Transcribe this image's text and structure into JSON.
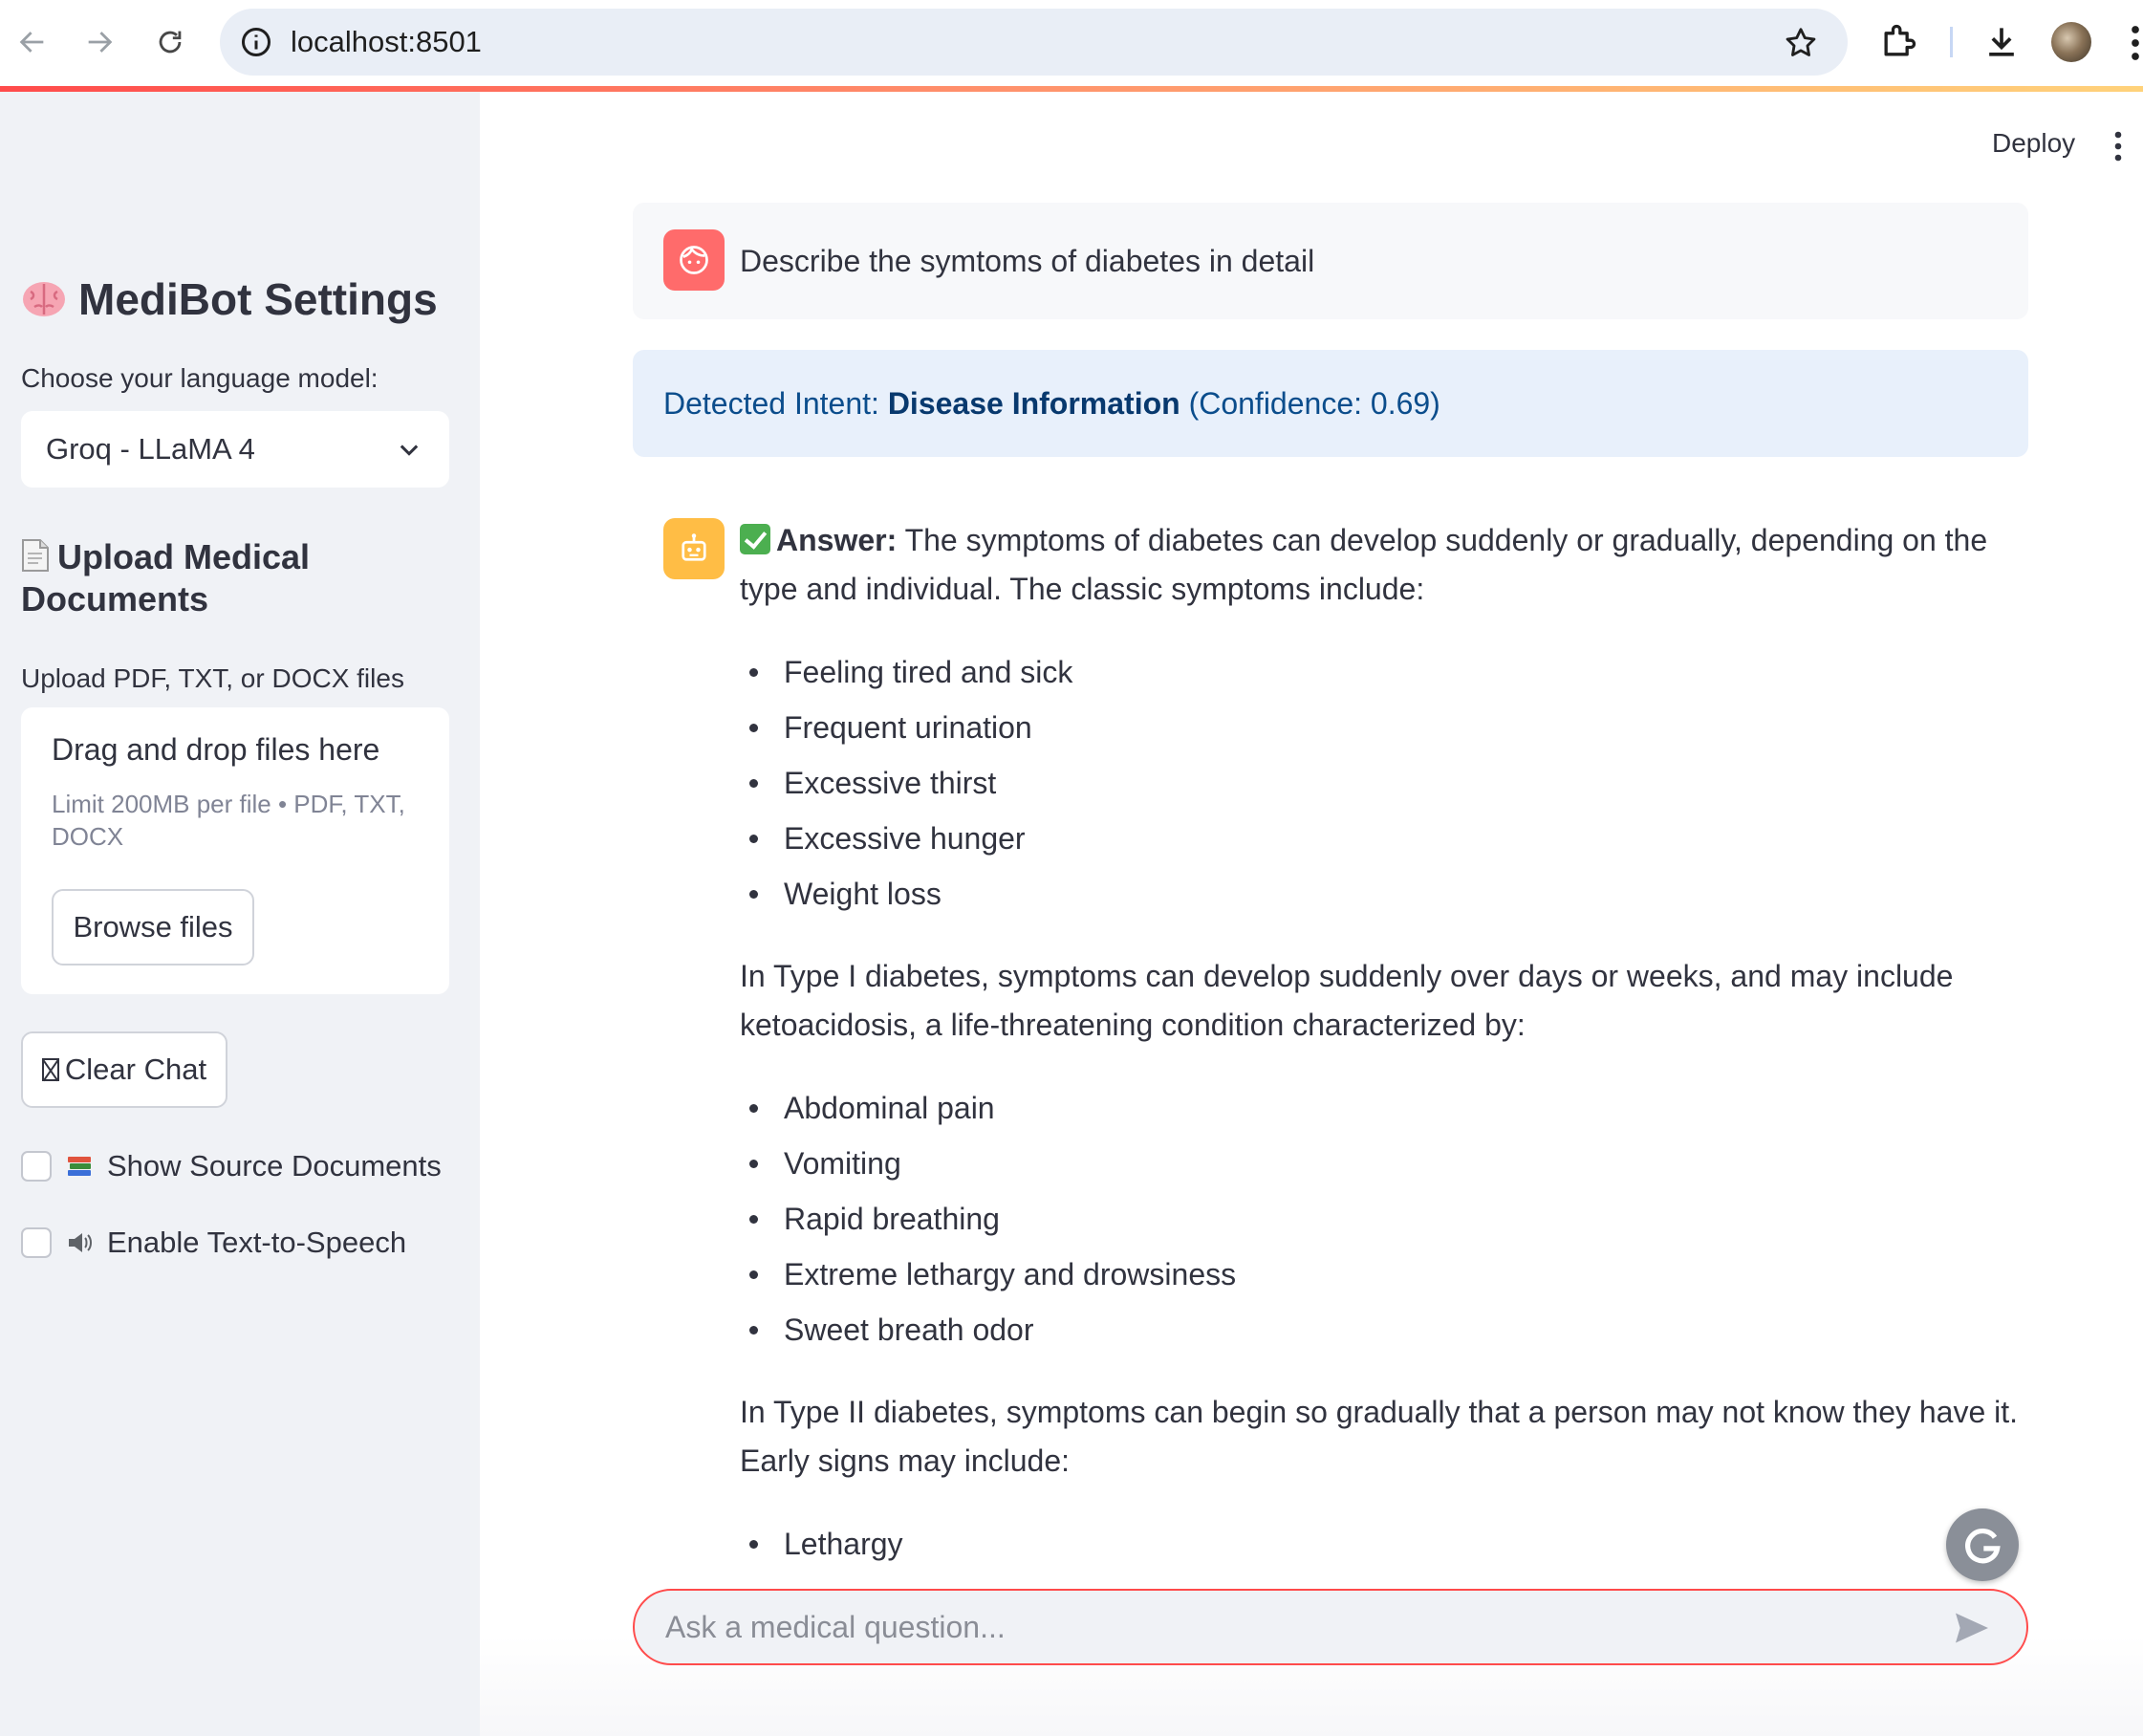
{
  "browser": {
    "url": "localhost:8501"
  },
  "header": {
    "deploy_label": "Deploy"
  },
  "sidebar": {
    "title": "MediBot Settings",
    "model_label": "Choose your language model:",
    "model_value": "Groq - LLaMA 4",
    "upload_heading": "Upload Medical Documents",
    "upload_label": "Upload PDF, TXT, or DOCX files",
    "dropzone_title": "Drag and drop files here",
    "dropzone_limit": "Limit 200MB per file • PDF, TXT, DOCX",
    "browse_label": "Browse files",
    "clear_label": "Clear Chat",
    "show_sources_label": "Show Source Documents",
    "tts_label": "Enable Text-to-Speech"
  },
  "chat": {
    "user_message": "Describe the symtoms of diabetes in detail",
    "intent_prefix": "Detected Intent: ",
    "intent_name": "Disease Information",
    "intent_confidence": " (Confidence: 0.69)",
    "answer_label": "Answer:",
    "answer_intro": " The symptoms of diabetes can develop suddenly or gradually, depending on the type and individual. The classic symptoms include:",
    "classic_symptoms": [
      "Feeling tired and sick",
      "Frequent urination",
      "Excessive thirst",
      "Excessive hunger",
      "Weight loss"
    ],
    "type1_text": "In Type I diabetes, symptoms can develop suddenly over days or weeks, and may include ketoacidosis, a life-threatening condition characterized by:",
    "type1_symptoms": [
      "Abdominal pain",
      "Vomiting",
      "Rapid breathing",
      "Extreme lethargy and drowsiness",
      "Sweet breath odor"
    ],
    "type2_text": "In Type II diabetes, symptoms can begin so gradually that a person may not know they have it. Early signs may include:",
    "type2_symptoms": [
      "Lethargy"
    ],
    "input_placeholder": "Ask a medical question..."
  },
  "colors": {
    "accent": "#ff4b4b",
    "sidebar_bg": "#f0f2f6",
    "intent_bg": "#e8f0fb",
    "intent_text": "#0b4d8c",
    "user_avatar": "#ff6b6b",
    "bot_avatar": "#ffbd45"
  }
}
